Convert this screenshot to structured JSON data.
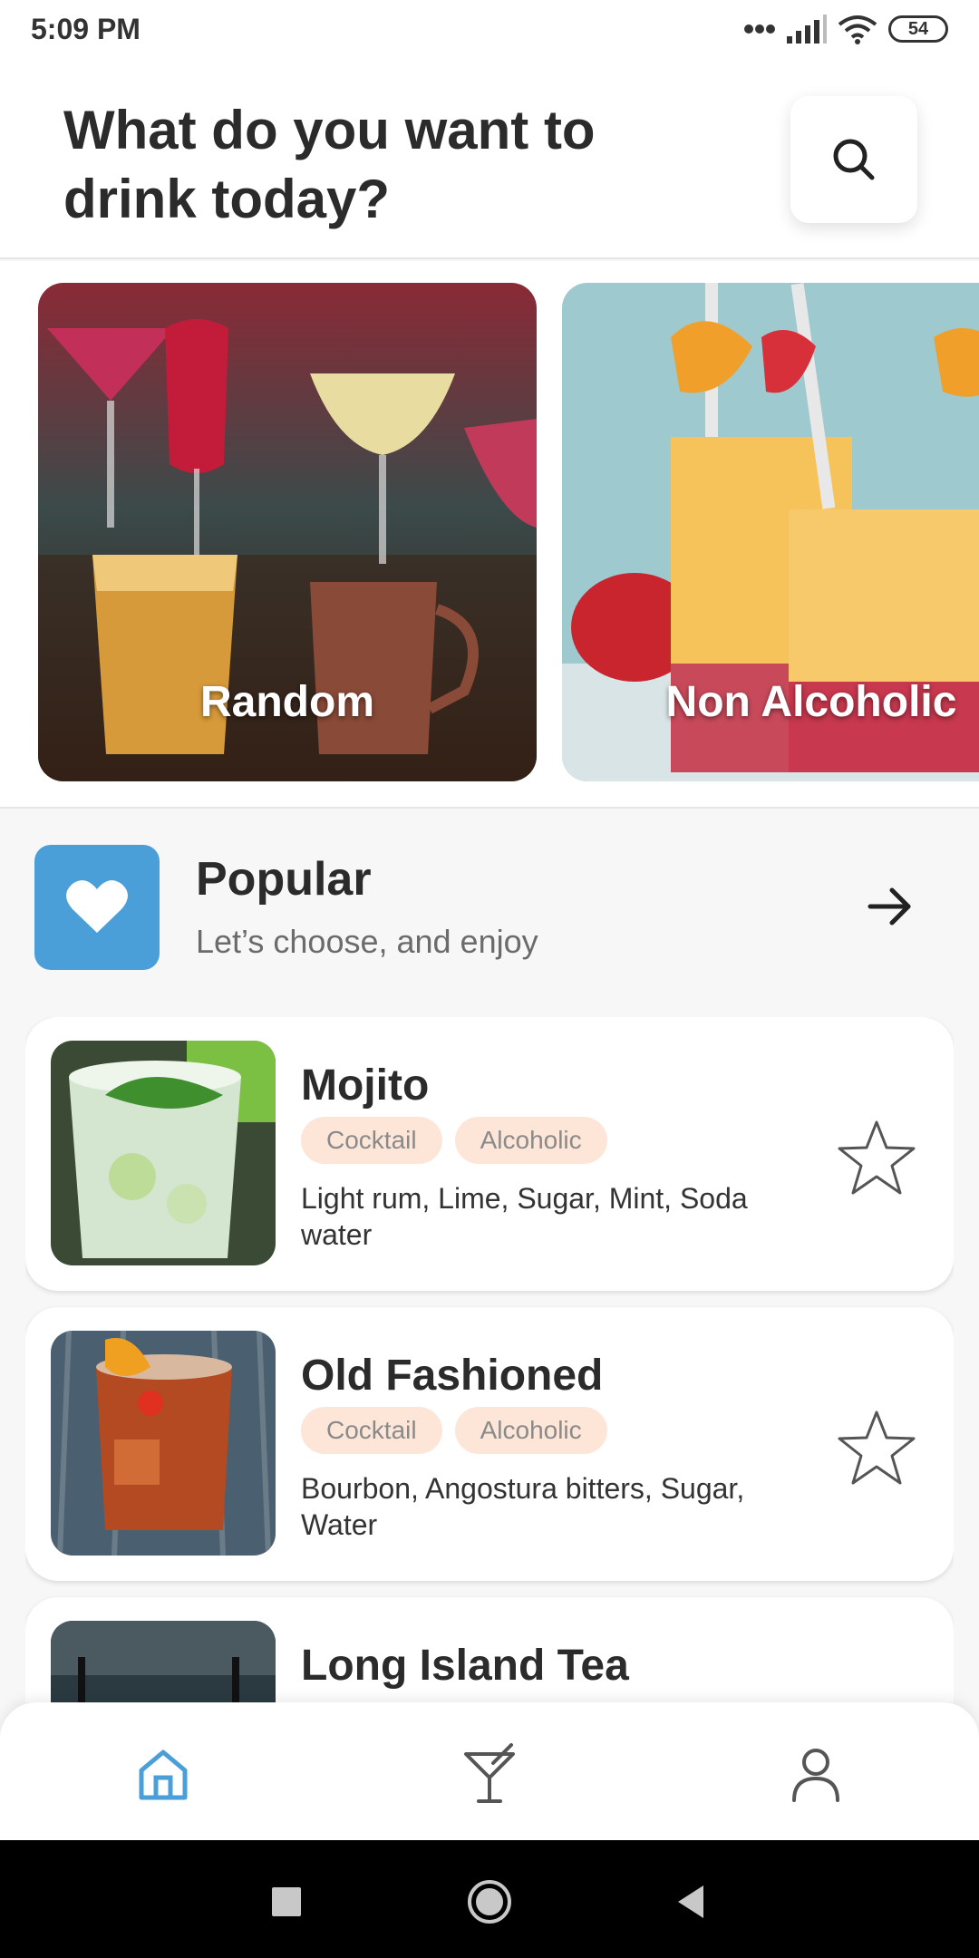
{
  "status_bar": {
    "time": "5:09 PM",
    "battery": "54",
    "icons": [
      "dots-icon",
      "signal-icon",
      "wifi-icon",
      "battery-icon"
    ]
  },
  "header": {
    "title": "What do you want to drink today?",
    "search_icon": "search-icon"
  },
  "categories": [
    {
      "label": "Random"
    },
    {
      "label": "Non Alcoholic"
    }
  ],
  "popular": {
    "title": "Popular",
    "subtitle": "Let’s choose, and enjoy",
    "icon": "heart-icon",
    "accent_color": "#4a9fd8"
  },
  "drinks": [
    {
      "name": "Mojito",
      "tags": [
        "Cocktail",
        "Alcoholic"
      ],
      "ingredients": "Light rum, Lime, Sugar, Mint, Soda water"
    },
    {
      "name": "Old Fashioned",
      "tags": [
        "Cocktail",
        "Alcoholic"
      ],
      "ingredients": "Bourbon, Angostura bitters, Sugar, Water"
    },
    {
      "name": "Long Island Tea",
      "tags": [
        "",
        ""
      ],
      "ingredients": ""
    }
  ],
  "bottom_nav": {
    "items": [
      {
        "icon": "home-icon",
        "active": true
      },
      {
        "icon": "cocktail-icon",
        "active": false
      },
      {
        "icon": "profile-icon",
        "active": false
      }
    ],
    "active_color": "#4a9fd8"
  },
  "colors": {
    "tag_bg": "#fde6d8",
    "accent": "#4a9fd8"
  }
}
